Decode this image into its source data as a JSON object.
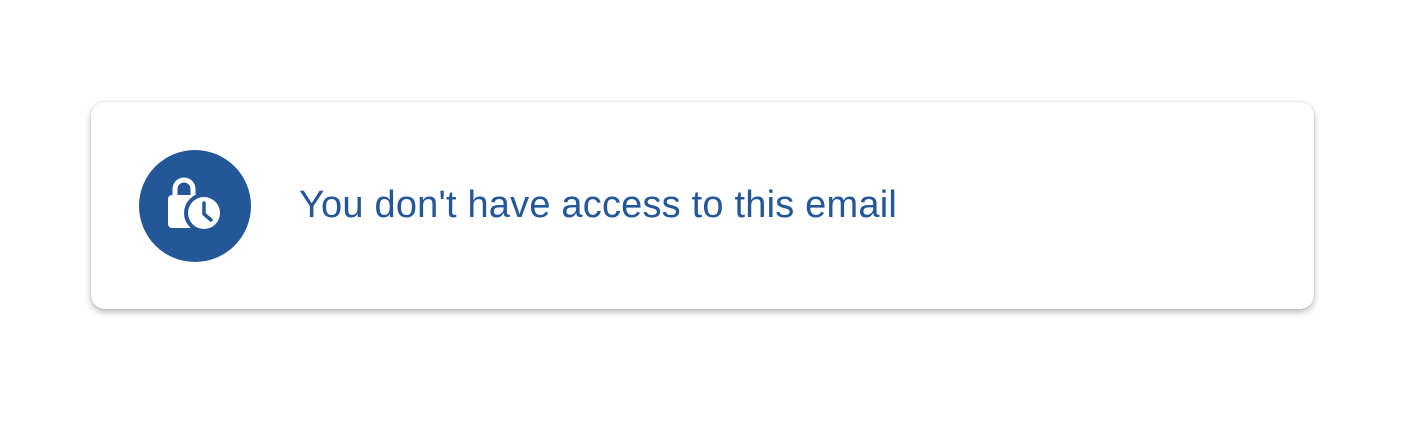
{
  "notice": {
    "message": "You don't have access to this email",
    "icon": "lock-clock-icon"
  },
  "colors": {
    "accent": "#245797",
    "card_background": "#ffffff",
    "page_background": "#ffffff"
  }
}
